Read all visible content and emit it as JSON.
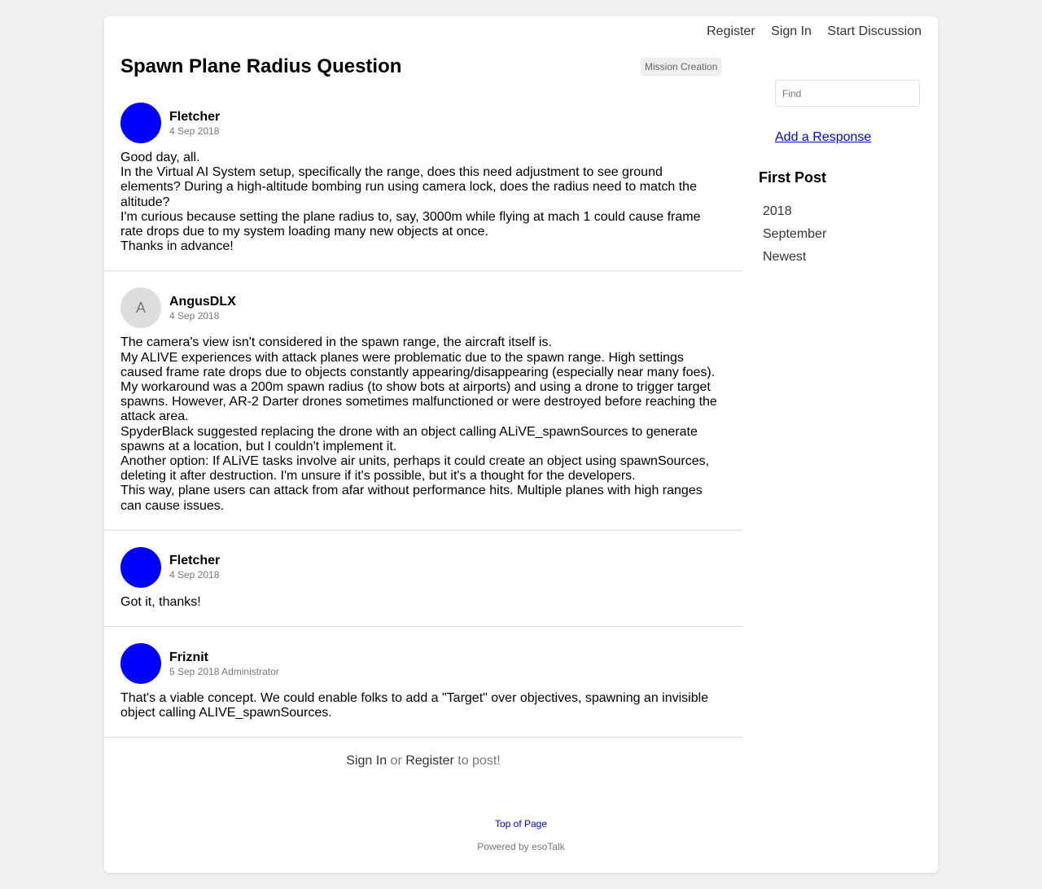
{
  "nav": {
    "register": "Register",
    "sign_in": "Sign In",
    "start_discussion": "Start Discussion"
  },
  "discussion": {
    "title": "Spawn Plane Radius Question",
    "tag": "Mission Creation"
  },
  "posts": [
    {
      "author": "Fletcher",
      "meta": "4 Sep 2018",
      "avatar": "",
      "avatar_color": "#0000ff",
      "lines": [
        "Good day, all.",
        "In the Virtual AI System setup, specifically the range, does this need adjustment to see ground elements? During a high-altitude bombing run using camera lock, does the radius need to match the altitude?",
        "I'm curious because setting the plane radius to, say, 3000m while flying at mach 1 could cause frame rate drops due to my system loading many new objects at once.",
        "Thanks in advance!"
      ]
    },
    {
      "author": "AngusDLX",
      "meta": "4 Sep 2018",
      "avatar": "A",
      "avatar_color": "#dddddd",
      "lines": [
        "The camera's view isn't considered in the spawn range, the aircraft itself is.",
        "My ALIVE experiences with attack planes were problematic due to the spawn range. High settings caused frame rate drops due to objects constantly appearing/disappearing (especially near many foes).",
        "My workaround was a 200m spawn radius (to show bots at airports) and using a drone to trigger target spawns. However, AR-2 Darter drones sometimes malfunctioned or were destroyed before reaching the attack area.",
        "SpyderBlack suggested replacing the drone with an object calling ALiVE_spawnSources to generate spawns at a location, but I couldn't implement it.",
        "Another option: If ALiVE tasks involve air units, perhaps it could create an object using spawnSources, deleting it after destruction. I'm unsure if it's possible, but it's a thought for the developers.",
        "This way, plane users can attack from afar without performance hits. Multiple planes with high ranges can cause issues."
      ]
    },
    {
      "author": "Fletcher",
      "meta": "4 Sep 2018",
      "avatar": "",
      "avatar_color": "#0000ff",
      "lines": [
        "Got it, thanks!"
      ]
    },
    {
      "author": "Friznit",
      "meta": "5 Sep 2018 Administrator",
      "avatar": "",
      "avatar_color": "#0000ff",
      "lines": [
        "That's a viable concept. We could enable folks to add a \"Target\" over objectives, spawning an invisible object calling ALIVE_spawnSources."
      ]
    }
  ],
  "reply": {
    "sign_in": "Sign In",
    "or": " or ",
    "register": "Register",
    "suffix": " to post!"
  },
  "footer": {
    "top": "Top of Page",
    "powered": "Powered by esoTalk"
  },
  "sidebar": {
    "find_placeholder": "Find",
    "add_response": "Add a Response",
    "heading": "First Post",
    "timeline": [
      "2018",
      "September",
      "Newest"
    ]
  },
  "colors": {
    "link": "#0000ff",
    "avatar": "#0000ff"
  }
}
